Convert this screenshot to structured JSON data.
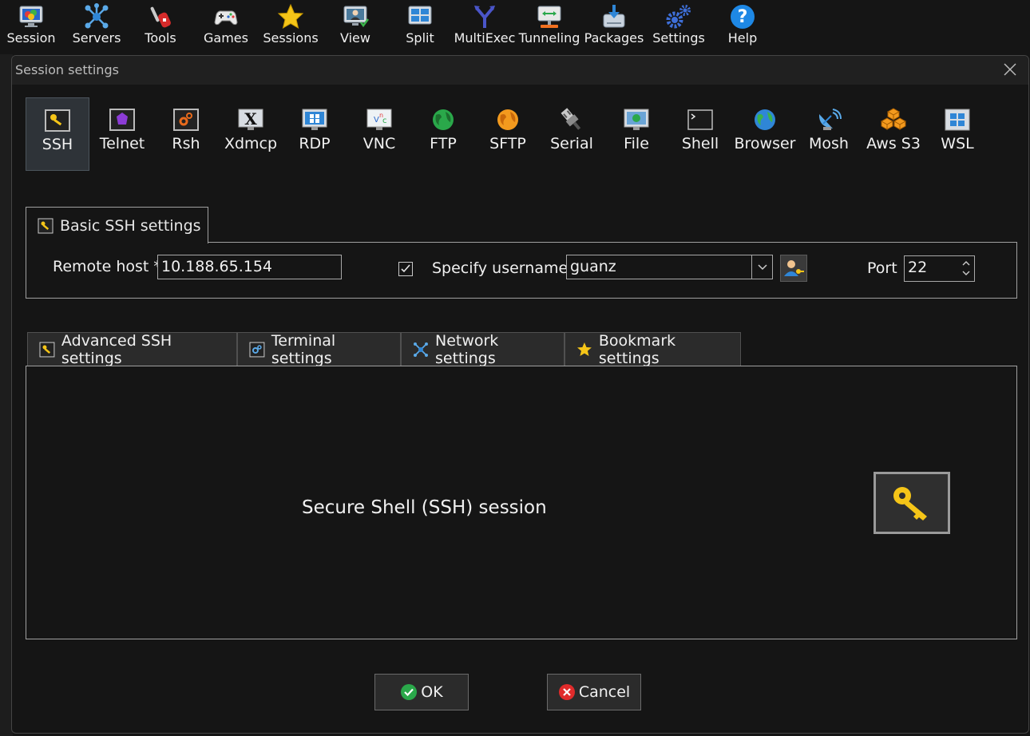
{
  "toolbar": {
    "items": [
      {
        "label": "Session",
        "icon": "session-monitor-icon"
      },
      {
        "label": "Servers",
        "icon": "servers-network-icon"
      },
      {
        "label": "Tools",
        "icon": "tools-knife-icon"
      },
      {
        "label": "Games",
        "icon": "gamepad-icon"
      },
      {
        "label": "Sessions",
        "icon": "star-icon"
      },
      {
        "label": "View",
        "icon": "view-monitor-icon"
      },
      {
        "label": "Split",
        "icon": "split-window-icon"
      },
      {
        "label": "MultiExec",
        "icon": "multiexec-fork-icon"
      },
      {
        "label": "Tunneling",
        "icon": "tunneling-icon"
      },
      {
        "label": "Packages",
        "icon": "packages-icon"
      },
      {
        "label": "Settings",
        "icon": "gears-icon"
      },
      {
        "label": "Help",
        "icon": "help-question-icon"
      }
    ]
  },
  "dialog": {
    "title": "Session settings",
    "session_types": [
      {
        "label": "SSH",
        "icon": "ssh-key-icon",
        "selected": true
      },
      {
        "label": "Telnet",
        "icon": "telnet-icon"
      },
      {
        "label": "Rsh",
        "icon": "rsh-icon"
      },
      {
        "label": "Xdmcp",
        "icon": "xdmcp-icon"
      },
      {
        "label": "RDP",
        "icon": "rdp-icon"
      },
      {
        "label": "VNC",
        "icon": "vnc-icon"
      },
      {
        "label": "FTP",
        "icon": "ftp-globe-icon"
      },
      {
        "label": "SFTP",
        "icon": "sftp-globe-icon"
      },
      {
        "label": "Serial",
        "icon": "serial-plug-icon"
      },
      {
        "label": "File",
        "icon": "file-monitor-icon"
      },
      {
        "label": "Shell",
        "icon": "shell-terminal-icon"
      },
      {
        "label": "Browser",
        "icon": "browser-globe-icon"
      },
      {
        "label": "Mosh",
        "icon": "mosh-satellite-icon"
      },
      {
        "label": "Aws S3",
        "icon": "aws-s3-cubes-icon"
      },
      {
        "label": "WSL",
        "icon": "wsl-windows-icon"
      }
    ],
    "basic_tab_label": "Basic SSH settings",
    "remote_host_label": "Remote host *",
    "remote_host_value": "10.188.65.154",
    "specify_username_label": "Specify username",
    "specify_username_checked": true,
    "username_value": "guanz",
    "port_label": "Port",
    "port_value": "22",
    "advanced_tabs": [
      {
        "label": "Advanced SSH settings",
        "icon": "wrench-key-icon"
      },
      {
        "label": "Terminal settings",
        "icon": "terminal-gear-icon"
      },
      {
        "label": "Network settings",
        "icon": "network-icon"
      },
      {
        "label": "Bookmark settings",
        "icon": "star-icon"
      }
    ],
    "session_description": "Secure Shell (SSH) session",
    "ok_label": "OK",
    "cancel_label": "Cancel"
  }
}
